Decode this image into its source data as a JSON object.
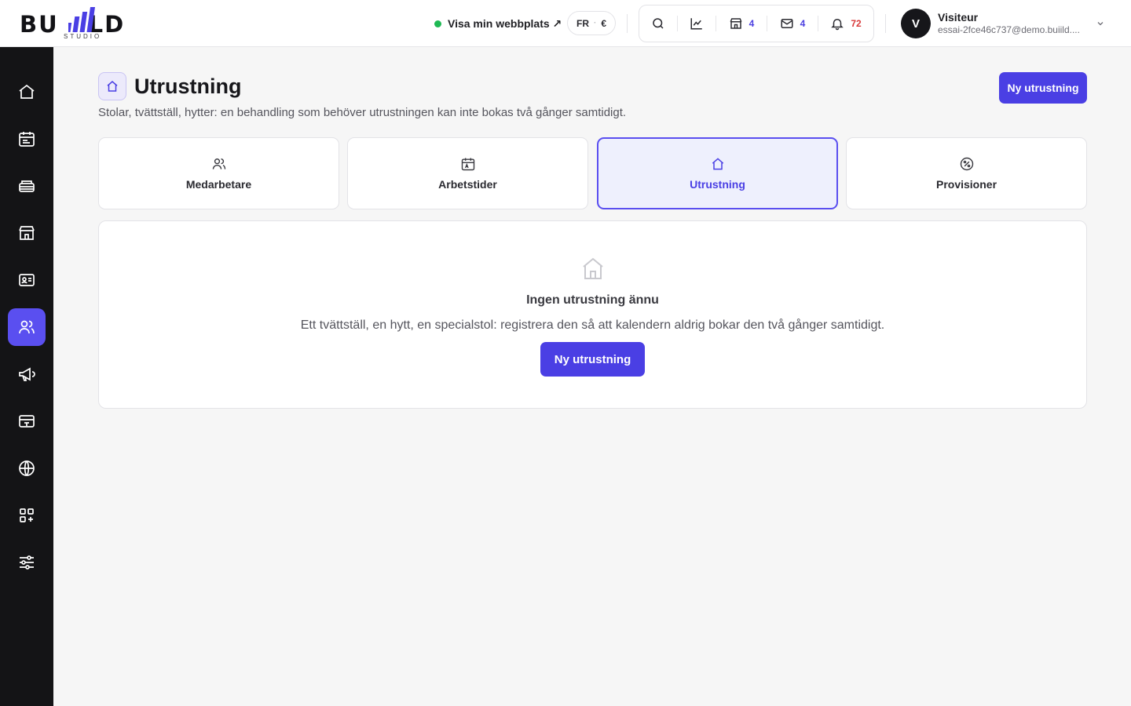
{
  "brand": {
    "logo_left": "BU",
    "logo_right": "LD",
    "logo_sub": "STUDIO",
    "accent": "#4a3fe4"
  },
  "header": {
    "site_link": "Visa min webbplats ↗",
    "lang": "FR",
    "currency": "€",
    "tools": {
      "search_icon": "search-icon",
      "stats_icon": "chart-icon",
      "shop_count": "4",
      "mail_count": "4",
      "notif_count": "72"
    },
    "user": {
      "initial": "V",
      "name": "Visiteur",
      "email": "essai-2fce46c737@demo.buiild...."
    }
  },
  "sidebar": {
    "items": [
      {
        "icon": "home-icon"
      },
      {
        "icon": "calendar-icon"
      },
      {
        "icon": "services-icon"
      },
      {
        "icon": "store-icon"
      },
      {
        "icon": "contact-card-icon"
      },
      {
        "icon": "team-icon",
        "active": true
      },
      {
        "icon": "megaphone-icon"
      },
      {
        "icon": "payment-icon"
      },
      {
        "icon": "globe-icon"
      },
      {
        "icon": "apps-icon"
      },
      {
        "icon": "settings-sliders-icon"
      }
    ]
  },
  "page": {
    "title": "Utrustning",
    "subtitle": "Stolar, tvättställ, hytter: en behandling som behöver utrustningen kan inte bokas två gånger samtidigt.",
    "new_button": "Ny utrustning"
  },
  "tabs": [
    {
      "label": "Medarbetare",
      "icon": "users-icon"
    },
    {
      "label": "Arbetstider",
      "icon": "calendar-icon"
    },
    {
      "label": "Utrustning",
      "icon": "home-icon",
      "active": true
    },
    {
      "label": "Provisioner",
      "icon": "percent-icon"
    }
  ],
  "empty_state": {
    "title": "Ingen utrustning ännu",
    "text": "Ett tvättställ, en hytt, en specialstol: registrera den så att kalendern aldrig bokar den två gånger samtidigt.",
    "button": "Ny utrustning"
  }
}
